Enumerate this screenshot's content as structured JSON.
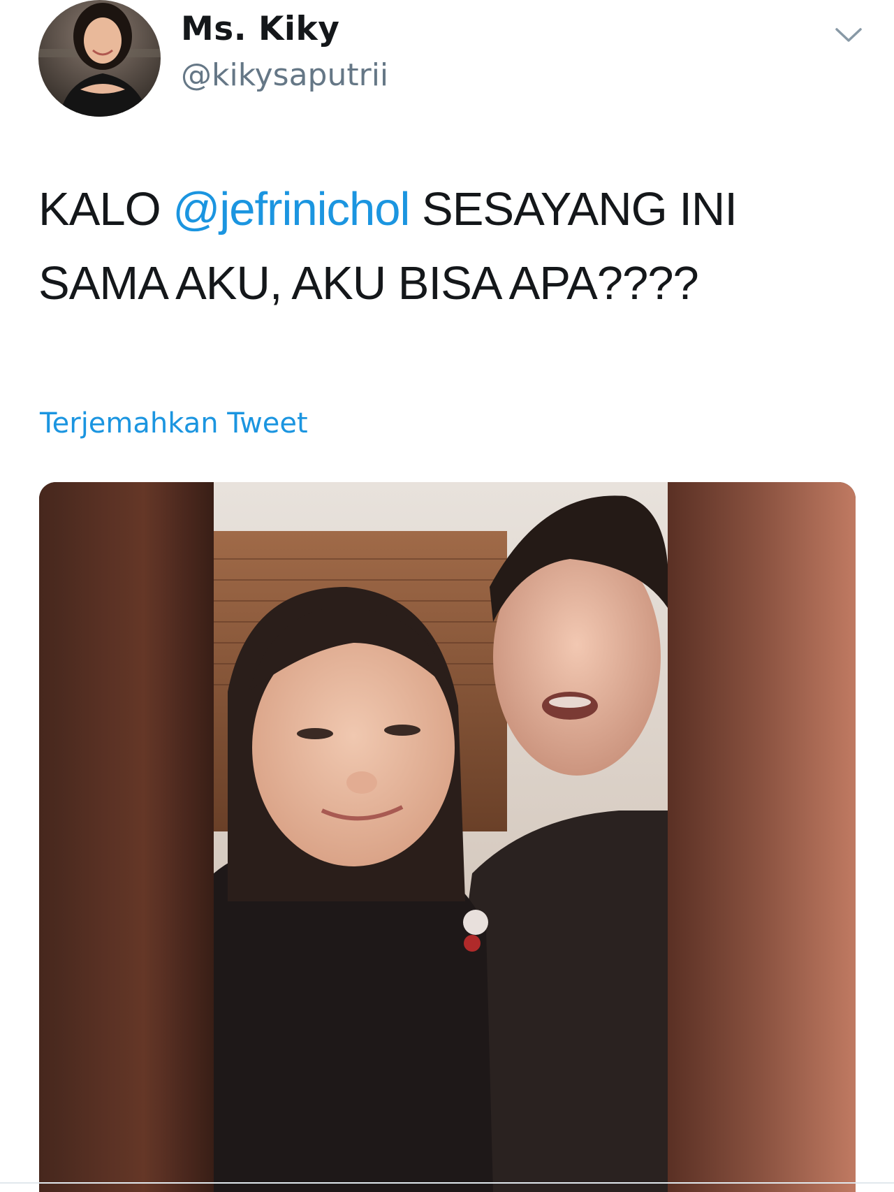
{
  "author": {
    "display_name": "Ms. Kiky",
    "handle": "@kikysaputrii",
    "avatar_icon": "profile-photo"
  },
  "tweet": {
    "text_before": "KALO ",
    "mention": "@jefrinichol",
    "text_after": " SESAYANG INI\nSAMA AKU, AKU BISA APA????"
  },
  "actions": {
    "translate_label": "Terjemahkan Tweet",
    "menu_icon": "chevron-down-icon"
  },
  "media": {
    "type": "video-still",
    "description_icon": "photo-of-two-people"
  },
  "colors": {
    "link": "#1b95e0",
    "text": "#14171a",
    "secondary": "#657786"
  }
}
